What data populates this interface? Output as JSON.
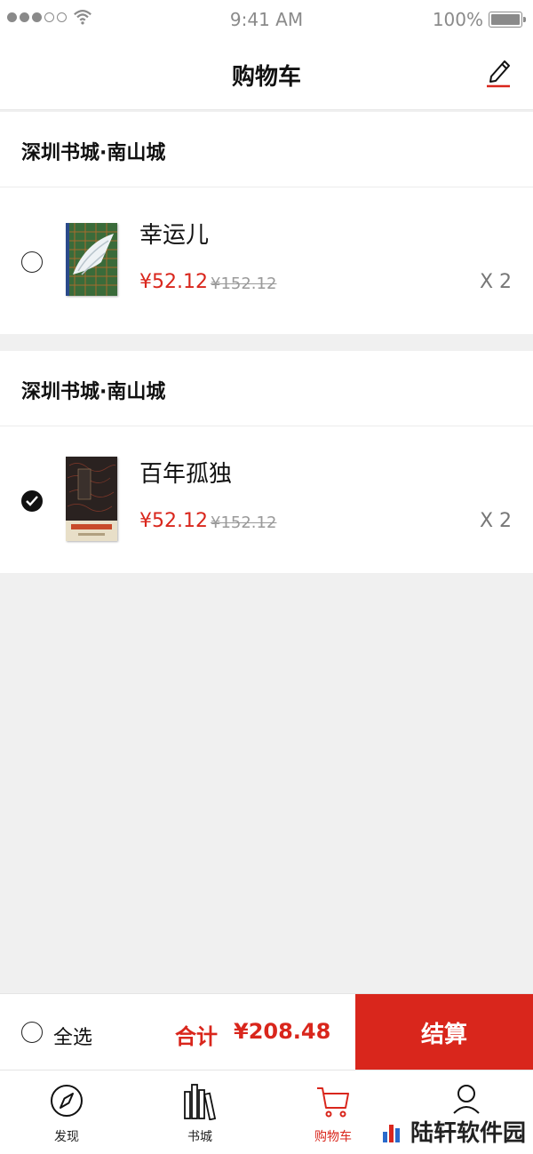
{
  "status_bar": {
    "time": "9:41 AM",
    "battery": "100%"
  },
  "header": {
    "title": "购物车",
    "edit_icon": "pencil-icon"
  },
  "stores": [
    {
      "name": "深圳书城·南山城",
      "item": {
        "title": "幸运儿",
        "price": "¥52.12",
        "original_price": "¥152.12",
        "quantity": "X 2",
        "checked": false
      }
    },
    {
      "name": "深圳书城·南山城",
      "item": {
        "title": "百年孤独",
        "price": "¥52.12",
        "original_price": "¥152.12",
        "quantity": "X 2",
        "checked": true
      }
    }
  ],
  "checkout": {
    "select_all_label": "全选",
    "total_label": "合计",
    "total_amount": "¥208.48",
    "button_label": "结算"
  },
  "tabs": [
    {
      "label": "发现",
      "icon": "compass-icon"
    },
    {
      "label": "书城",
      "icon": "books-icon"
    },
    {
      "label": "购物车",
      "icon": "cart-icon",
      "active": true
    },
    {
      "label": "",
      "icon": "user-icon"
    }
  ],
  "watermark": "陆轩软件园",
  "colors": {
    "accent": "#d9261c",
    "background": "#f0f0f0"
  }
}
